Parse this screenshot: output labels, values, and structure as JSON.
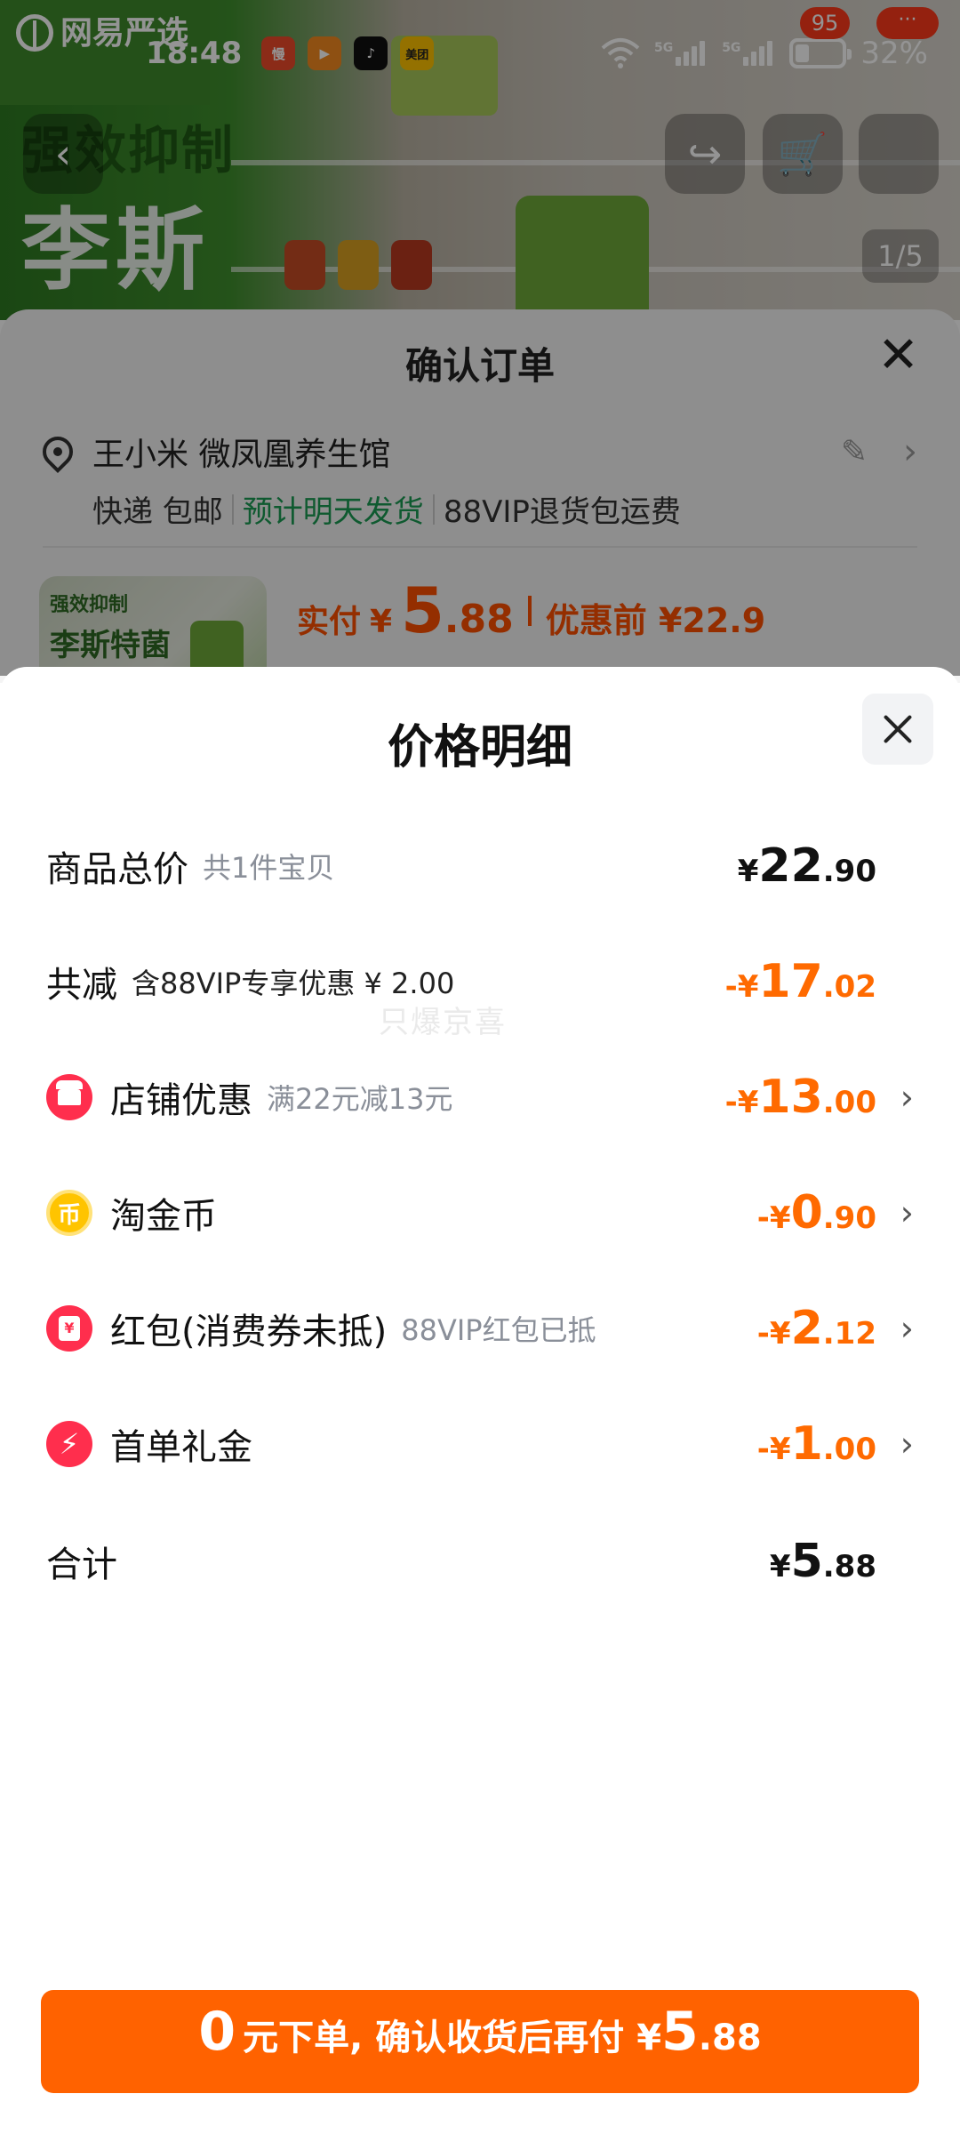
{
  "status_bar": {
    "time": "18:48",
    "apps": [
      {
        "name": "慢",
        "color": "#f04a2a"
      },
      {
        "name": "▶",
        "color": "#f58a1f"
      },
      {
        "name": "♪",
        "color": "#111111"
      },
      {
        "name": "美团",
        "color": "#ffc300"
      }
    ],
    "network1": "5G",
    "network2": "5G",
    "battery": "32%"
  },
  "background": {
    "brand": "网易严选",
    "hero_line1": "强效抑制",
    "hero_line2": "李斯",
    "cart_count": "95",
    "more_label": "···",
    "pager": "1/5"
  },
  "order": {
    "title": "确认订单",
    "address": "王小米 微凤凰养生馆",
    "ship_method": "快递 包邮",
    "ship_time": "预计明天发货",
    "ship_service": "88VIP退货包运费",
    "thumb_line1": "强效抑制",
    "thumb_line2": "李斯特菌",
    "pay_label": "实付",
    "pay_yen": "¥",
    "pay_int": "5",
    "pay_dec": ".88",
    "before_label": "优惠前 ¥22.9"
  },
  "detail": {
    "title": "价格明细",
    "watermark": "只爆京喜",
    "total_goods": {
      "label": "商品总价",
      "sub": "共1件宝贝",
      "yen": "¥",
      "int": "22",
      "dec": ".90"
    },
    "total_discount": {
      "label": "共减",
      "sub": "含88VIP专享优惠 ¥ 2.00",
      "yen": "-¥",
      "int": "17",
      "dec": ".02"
    },
    "shop_discount": {
      "label": "店铺优惠",
      "sub": "满22元减13元",
      "yen": "-¥",
      "int": "13",
      "dec": ".00",
      "icon": "store-icon"
    },
    "tao_coin": {
      "label": "淘金币",
      "sub": "",
      "yen": "-¥",
      "int": "0",
      "dec": ".90",
      "icon": "coin-icon",
      "icon_glyph": "币"
    },
    "red_packet": {
      "label": "红包(消费券未抵)",
      "sub": "88VIP红包已抵",
      "yen": "-¥",
      "int": "2",
      "dec": ".12",
      "icon": "red-packet-icon",
      "icon_glyph": "¥"
    },
    "first_order": {
      "label": "首单礼金",
      "sub": "",
      "yen": "-¥",
      "int": "1",
      "dec": ".00",
      "icon": "lightning-icon",
      "icon_glyph": "⚡"
    },
    "sum": {
      "label": "合计",
      "yen": "¥",
      "int": "5",
      "dec": ".88"
    }
  },
  "bottom_button": {
    "big": "0",
    "text": "元下单, 确认收货后再付",
    "yen": "¥",
    "int": "5",
    "dec": ".88"
  },
  "colors": {
    "accent": "#ff6200",
    "discount": "#ff6a00",
    "green": "#1a9b53"
  }
}
